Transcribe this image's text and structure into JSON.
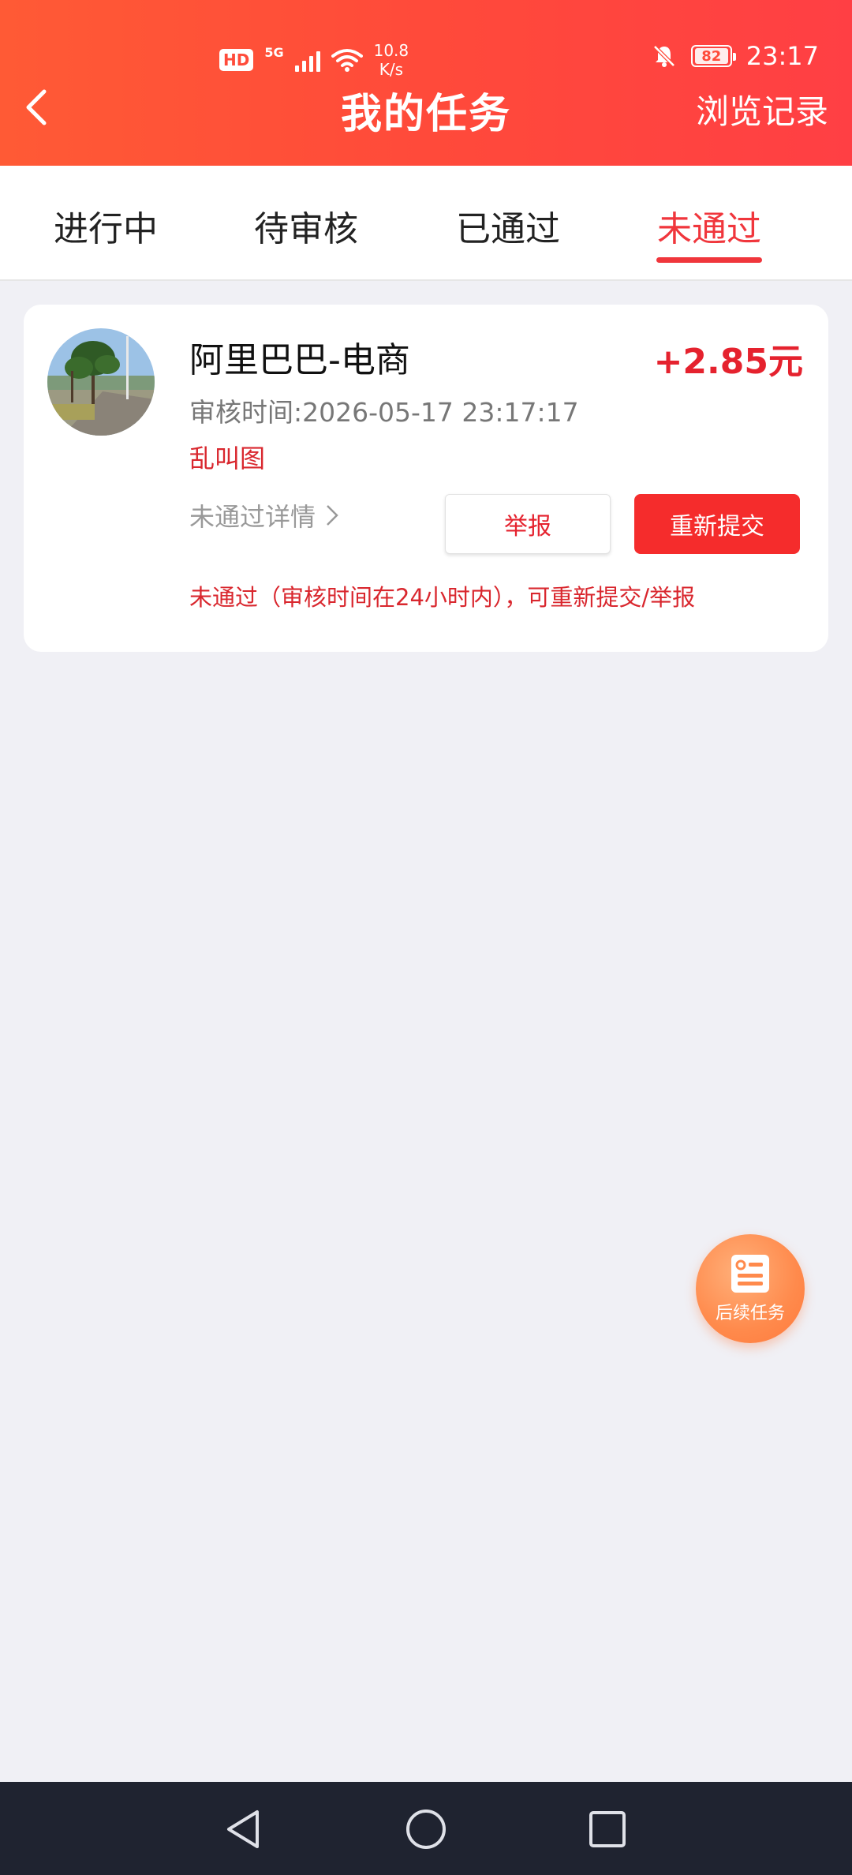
{
  "status_bar": {
    "hd": "HD",
    "network": "5G",
    "speed_value": "10.8",
    "speed_unit": "K/s",
    "battery": "82",
    "time": "23:17"
  },
  "header": {
    "title": "我的任务",
    "history": "浏览记录"
  },
  "tabs": [
    {
      "label": "进行中"
    },
    {
      "label": "待审核"
    },
    {
      "label": "已通过"
    },
    {
      "label": "未通过",
      "active": true
    }
  ],
  "task": {
    "name": "阿里巴巴-电商",
    "reward": "+2.85元",
    "review_time": "审核时间:2026-05-17 23:17:17",
    "reason": "乱叫图",
    "detail_link": "未通过详情",
    "report_button": "举报",
    "resubmit_button": "重新提交",
    "notice": "未通过（审核时间在24小时内），可重新提交/举报"
  },
  "fab": {
    "label": "后续任务"
  },
  "colors": {
    "accent": "#f0363c",
    "header_gradient_start": "#ff5a35",
    "header_gradient_end": "#ff3f44",
    "fab": "#ff8a4c"
  }
}
